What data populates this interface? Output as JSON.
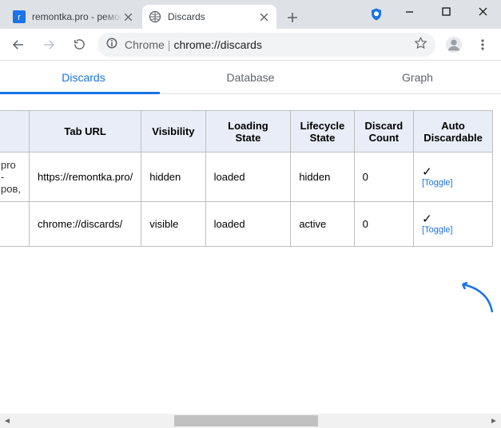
{
  "tabs": [
    {
      "title": "remontka.pro - ремон",
      "favicon_color": "#1a73e8"
    },
    {
      "title": "Discards"
    }
  ],
  "address": {
    "scheme_label": "Chrome",
    "url": "chrome://discards"
  },
  "pagetabs": {
    "discards": "Discards",
    "database": "Database",
    "graph": "Graph"
  },
  "table": {
    "headers": {
      "tab_url": "Tab URL",
      "visibility": "Visibility",
      "loading_state": "Loading State",
      "lifecycle_state": "Lifecycle State",
      "discard_count": "Discard Count",
      "auto_discardable": "Auto Discardable"
    },
    "rows": [
      {
        "stub": "pro - ров,",
        "url": "https://remontka.pro/",
        "visibility": "hidden",
        "loading_state": "loaded",
        "lifecycle_state": "hidden",
        "discard_count": "0",
        "auto_check": "✓",
        "toggle": "[Toggle]"
      },
      {
        "stub": "",
        "url": "chrome://discards/",
        "visibility": "visible",
        "loading_state": "loaded",
        "lifecycle_state": "active",
        "discard_count": "0",
        "auto_check": "✓",
        "toggle": "[Toggle]"
      }
    ]
  }
}
